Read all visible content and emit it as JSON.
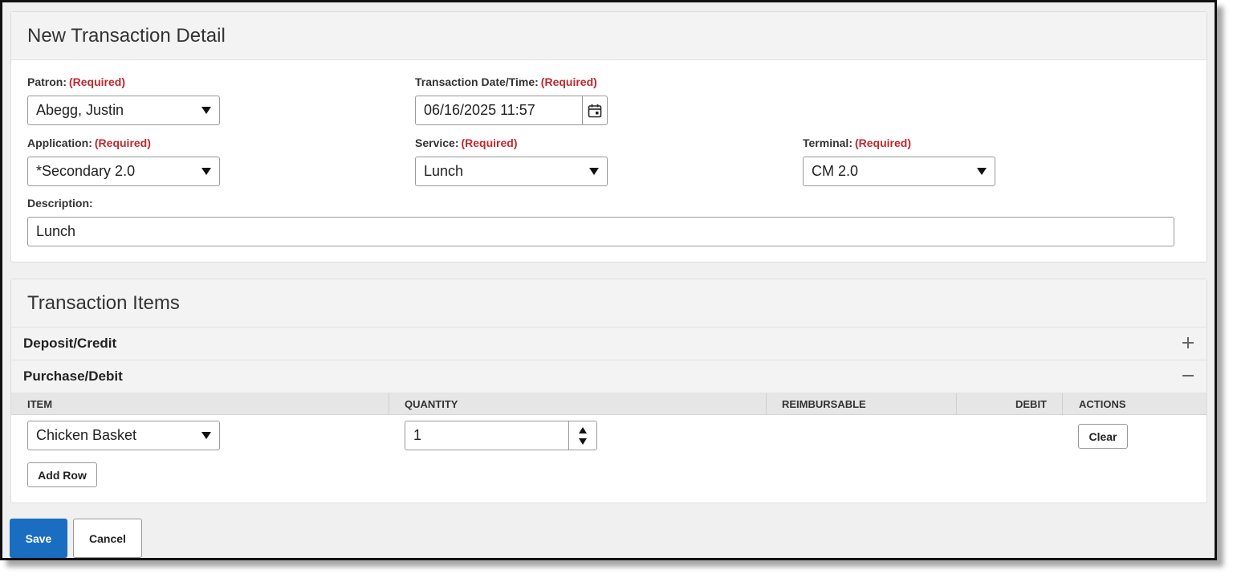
{
  "detail": {
    "title": "New Transaction Detail",
    "required_text": "(Required)",
    "patron": {
      "label": "Patron:",
      "value": "Abegg, Justin"
    },
    "datetime": {
      "label": "Transaction Date/Time:",
      "value": "06/16/2025 11:57"
    },
    "application": {
      "label": "Application:",
      "value": "*Secondary 2.0"
    },
    "service": {
      "label": "Service:",
      "value": "Lunch"
    },
    "terminal": {
      "label": "Terminal:",
      "value": "CM 2.0"
    },
    "description": {
      "label": "Description:",
      "value": "Lunch"
    }
  },
  "items": {
    "title": "Transaction Items",
    "deposit_label": "Deposit/Credit",
    "purchase_label": "Purchase/Debit",
    "columns": [
      "ITEM",
      "QUANTITY",
      "REIMBURSABLE",
      "DEBIT",
      "ACTIONS"
    ],
    "rows": [
      {
        "item": "Chicken Basket",
        "quantity": "1",
        "action": "Clear"
      }
    ],
    "add_row_label": "Add Row"
  },
  "footer": {
    "save_label": "Save",
    "cancel_label": "Cancel"
  },
  "colors": {
    "accent": "#1a6ec1",
    "required": "#c1272d"
  },
  "icons": [
    "caret-down-icon",
    "calendar-icon",
    "plus-icon",
    "minus-icon",
    "spinner-up-icon",
    "spinner-down-icon"
  ]
}
